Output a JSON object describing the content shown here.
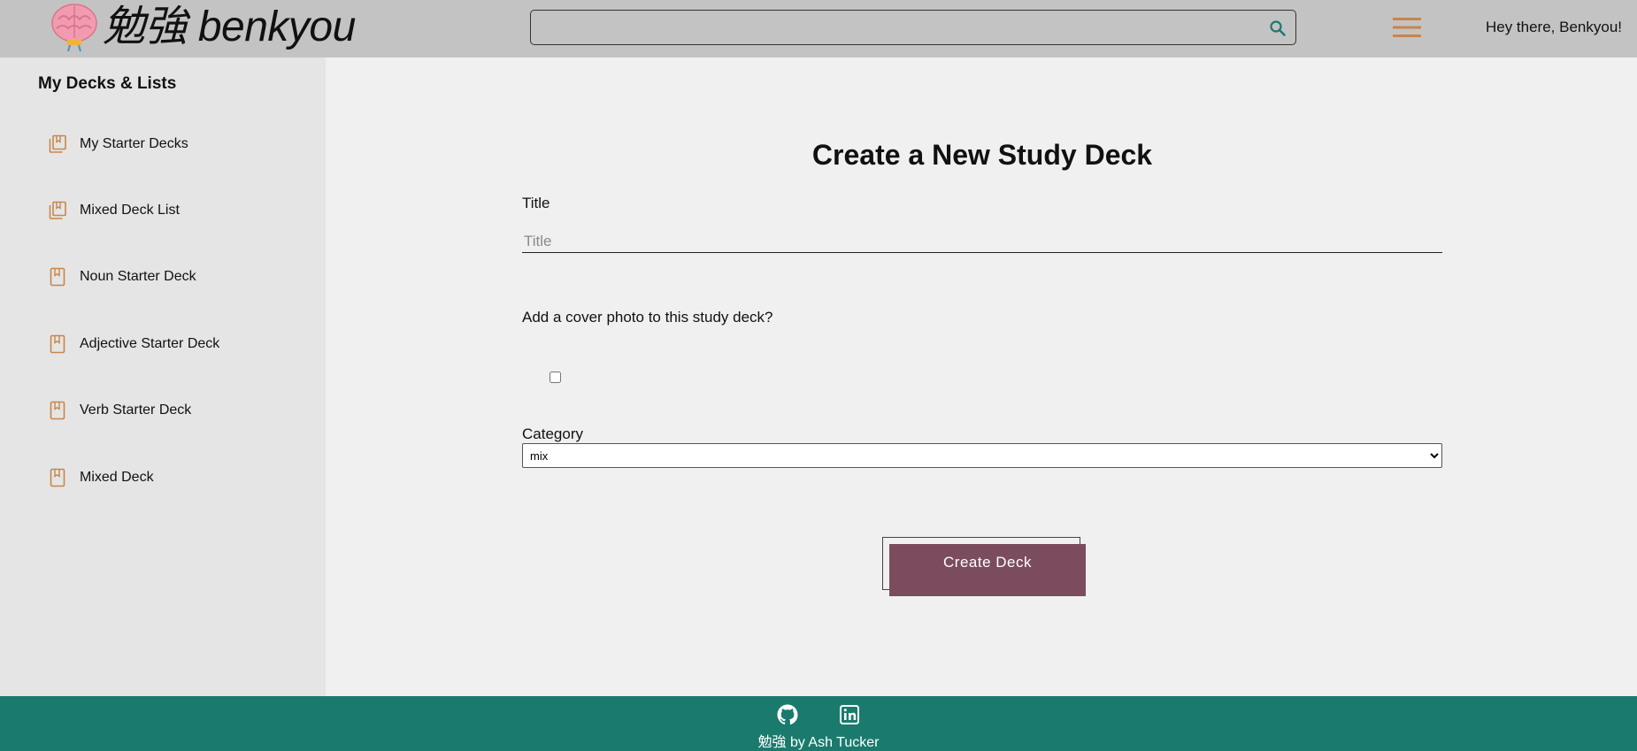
{
  "header": {
    "logo_text": "勉強 benkyou",
    "search_placeholder": "",
    "greeting": "Hey there, Benkyou!"
  },
  "sidebar": {
    "title": "My Decks & Lists",
    "items": [
      {
        "label": "My Starter Decks",
        "icon": "deck-list-icon"
      },
      {
        "label": "Mixed Deck List",
        "icon": "deck-list-icon"
      },
      {
        "label": "Noun Starter Deck",
        "icon": "deck-icon"
      },
      {
        "label": "Adjective Starter Deck",
        "icon": "deck-icon"
      },
      {
        "label": "Verb Starter Deck",
        "icon": "deck-icon"
      },
      {
        "label": "Mixed Deck",
        "icon": "deck-icon"
      }
    ]
  },
  "form": {
    "heading": "Create a New Study Deck",
    "title_label": "Title",
    "title_placeholder": "Title",
    "title_value": "",
    "cover_label": "Add a cover photo to this study deck?",
    "cover_checked": false,
    "category_label": "Category",
    "category_selected": "mix",
    "submit_label": "Create Deck"
  },
  "footer": {
    "credit": "勉強 by Ash Tucker",
    "icons": [
      "github-icon",
      "linkedin-icon"
    ]
  },
  "colors": {
    "header_bg": "#c3c3c3",
    "sidebar_bg": "#e5e5e5",
    "accent_orange": "#c8864a",
    "button_bg": "#7b4c5e",
    "footer_bg": "#1b7a6e",
    "search_icon": "#1b7a6e"
  }
}
